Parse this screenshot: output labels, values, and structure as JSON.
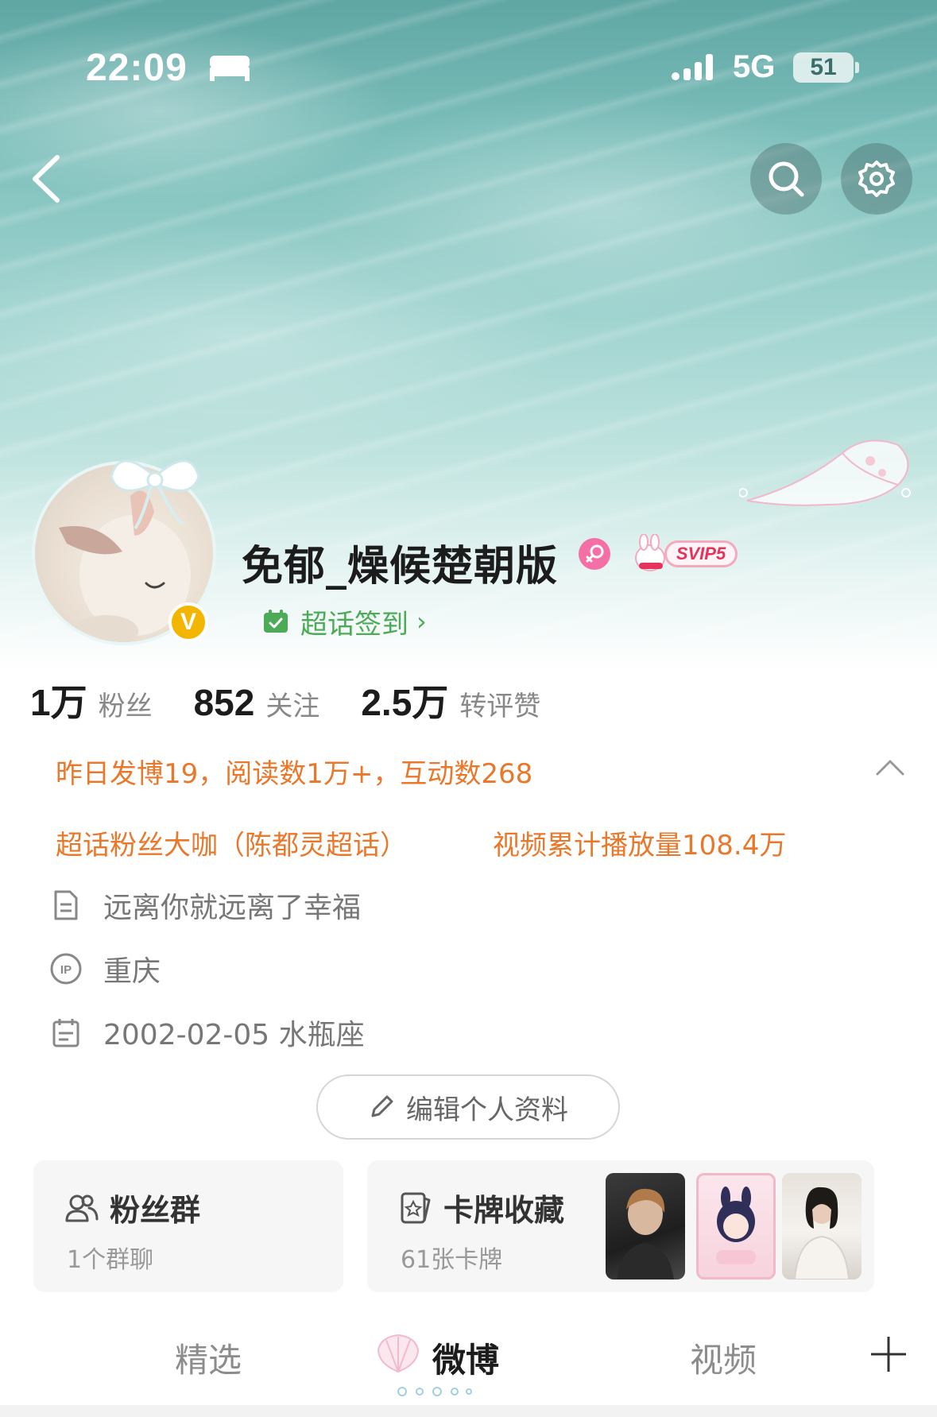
{
  "status_bar": {
    "time": "22:09",
    "network": "5G",
    "battery": "51"
  },
  "profile": {
    "username": "免郁_燥候楚朝版",
    "verify_badge": "V",
    "svip_badge": "SVIP5",
    "supertopic_checkin": "超话签到",
    "stats": [
      {
        "num": "1万",
        "label": "粉丝"
      },
      {
        "num": "852",
        "label": "关注"
      },
      {
        "num": "2.5万",
        "label": "转评赞"
      }
    ],
    "daily_summary": "昨日发博19，阅读数1万+，互动数268",
    "tags": [
      "超话粉丝大咖（陈都灵超话）",
      "视频累计播放量108.4万"
    ],
    "bio": "远离你就远离了幸福",
    "ip_location": "重庆",
    "birthday": "2002-02-05 水瓶座",
    "edit_button": "编辑个人资料"
  },
  "cards": {
    "fan_group": {
      "title": "粉丝群",
      "subtitle": "1个群聊"
    },
    "card_collection": {
      "title": "卡牌收藏",
      "subtitle": "61张卡牌"
    }
  },
  "tabs": {
    "featured": "精选",
    "weibo": "微博",
    "video": "视频"
  },
  "colors": {
    "accent_orange": "#e9782b",
    "supertopic_green": "#4cab57",
    "verify_gold": "#f3b600",
    "gender_pink": "#f36fa5"
  },
  "icons": [
    "bed-icon",
    "signal-icon",
    "back-icon",
    "search-icon",
    "gear-icon",
    "female-icon",
    "calendar-check-icon",
    "document-icon",
    "ip-icon",
    "calendar-icon",
    "pencil-icon",
    "group-icon",
    "card-icon",
    "shell-icon",
    "plus-icon",
    "chevron-up-icon"
  ]
}
